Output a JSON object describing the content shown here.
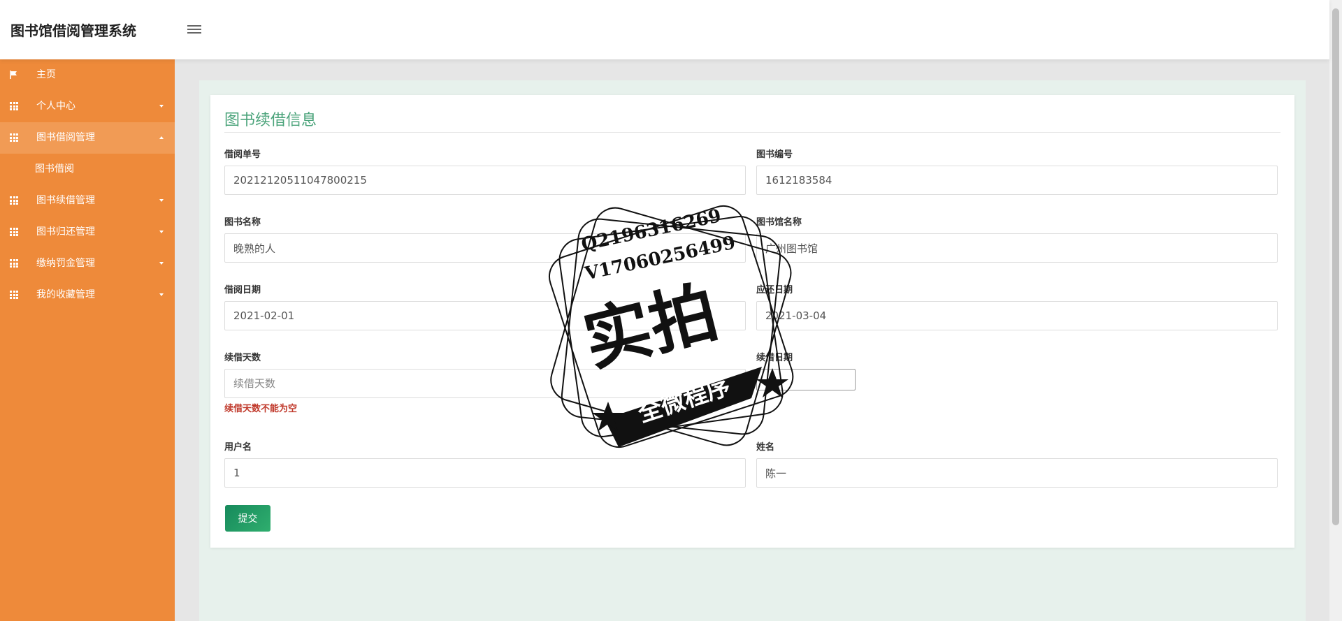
{
  "app": {
    "title": "图书馆借阅管理系统",
    "avatar_text": "80x80"
  },
  "sidebar": {
    "items": [
      {
        "label": "主页"
      },
      {
        "label": "个人中心"
      },
      {
        "label": "图书借阅管理"
      },
      {
        "label": "图书借阅"
      },
      {
        "label": "图书续借管理"
      },
      {
        "label": "图书归还管理"
      },
      {
        "label": "缴纳罚金管理"
      },
      {
        "label": "我的收藏管理"
      }
    ]
  },
  "form": {
    "title": "图书续借信息",
    "fields": {
      "borrow_no": {
        "label": "借阅单号",
        "value": "20212120511047800215"
      },
      "book_no": {
        "label": "图书编号",
        "value": "1612183584"
      },
      "book_name": {
        "label": "图书名称",
        "value": "晚熟的人"
      },
      "library_name": {
        "label": "图书馆名称",
        "value": "广州图书馆"
      },
      "borrow_date": {
        "label": "借阅日期",
        "value": "2021-02-01"
      },
      "due_date": {
        "label": "应还日期",
        "value": "2021-03-04"
      },
      "renew_days": {
        "label": "续借天数",
        "placeholder": "续借天数",
        "error": "续借天数不能为空"
      },
      "renew_date": {
        "label": "续借日期"
      },
      "username": {
        "label": "用户名",
        "value": "1"
      },
      "name": {
        "label": "姓名",
        "value": "陈一"
      }
    },
    "submit_label": "提交"
  },
  "watermark": {
    "line1": "Q2196316269",
    "line2": "V17060256499",
    "big": "实拍",
    "banner": "全微程序"
  }
}
